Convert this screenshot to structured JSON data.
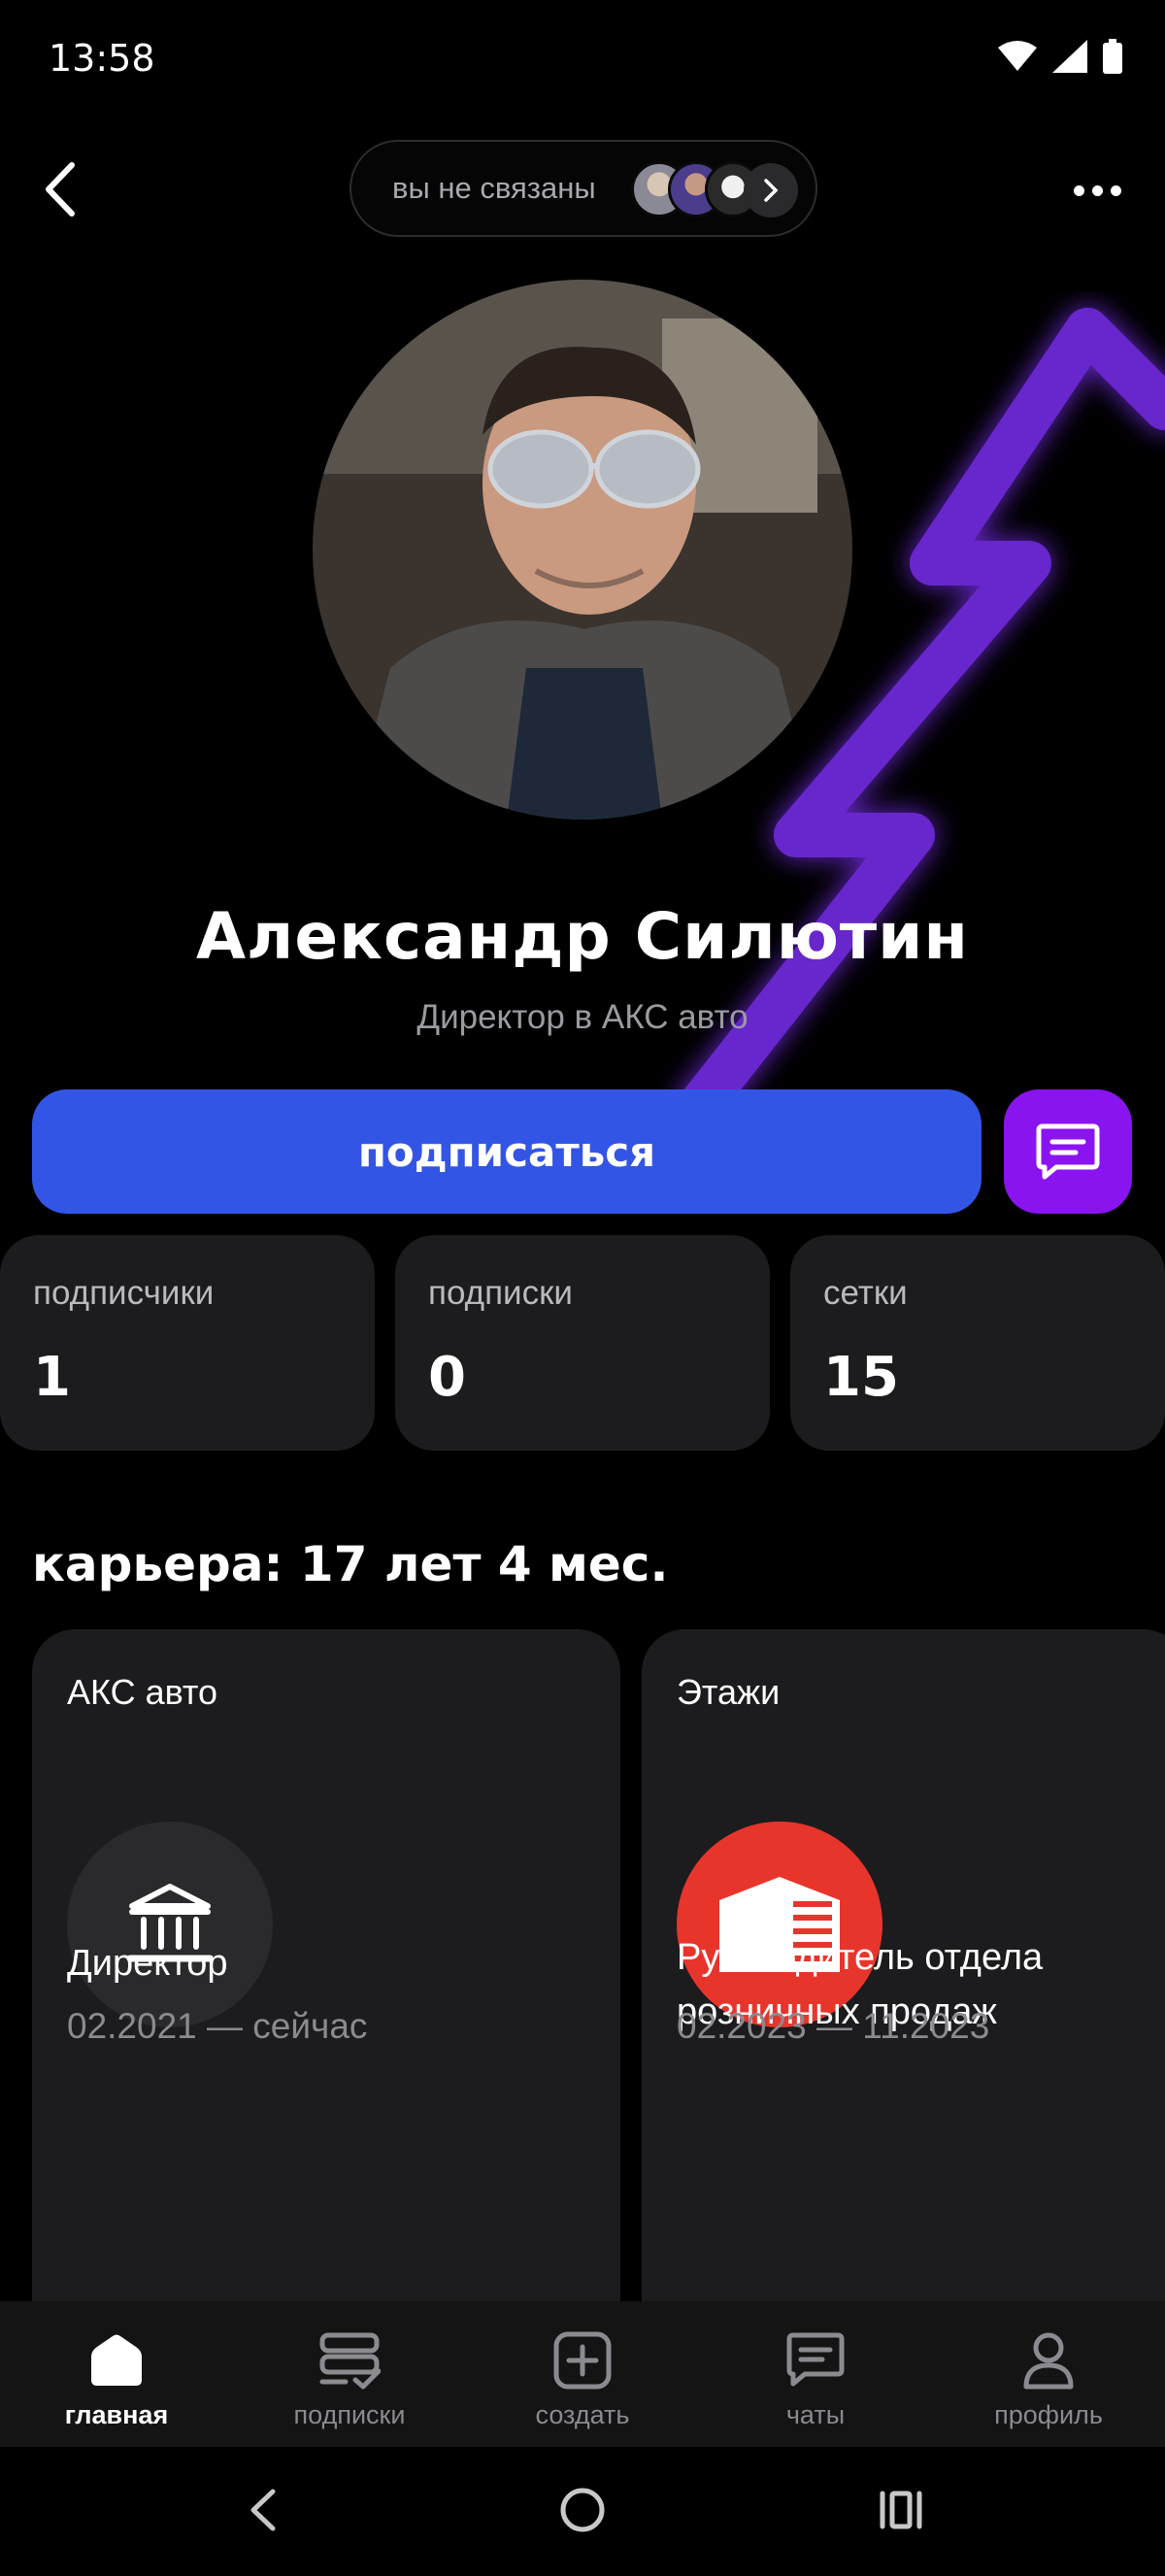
{
  "status_bar": {
    "time": "13:58"
  },
  "header": {
    "connection_text": "вы не связаны"
  },
  "profile": {
    "name": "Александр Силютин",
    "title": "Директор в АКС авто",
    "subscribe_label": "подписаться"
  },
  "stats": [
    {
      "label": "подписчики",
      "value": "1"
    },
    {
      "label": "подписки",
      "value": "0"
    },
    {
      "label": "сетки",
      "value": "15"
    }
  ],
  "career": {
    "heading": "карьера: 17 лет 4 мес.",
    "items": [
      {
        "company": "АКС авто",
        "role": "Директор",
        "period": "02.2021 — сейчас",
        "logo": "bank-icon"
      },
      {
        "company": "Этажи",
        "role_line1": "Руководитель отдела",
        "role_line2": "розничных продаж",
        "period": "02.2023 — 11.2023",
        "logo": "building-icon"
      }
    ]
  },
  "bottom_nav": [
    {
      "label": "главная",
      "icon": "home-icon",
      "active": true
    },
    {
      "label": "подписки",
      "icon": "subscriptions-icon",
      "active": false
    },
    {
      "label": "создать",
      "icon": "create-icon",
      "active": false
    },
    {
      "label": "чаты",
      "icon": "chat-icon",
      "active": false
    },
    {
      "label": "профиль",
      "icon": "profile-icon",
      "active": false
    }
  ],
  "colors": {
    "accent_blue": "#3355e6",
    "accent_purple": "#8a14f0",
    "card_bg": "#1c1c1e",
    "etazhi_red": "#e8352c"
  }
}
